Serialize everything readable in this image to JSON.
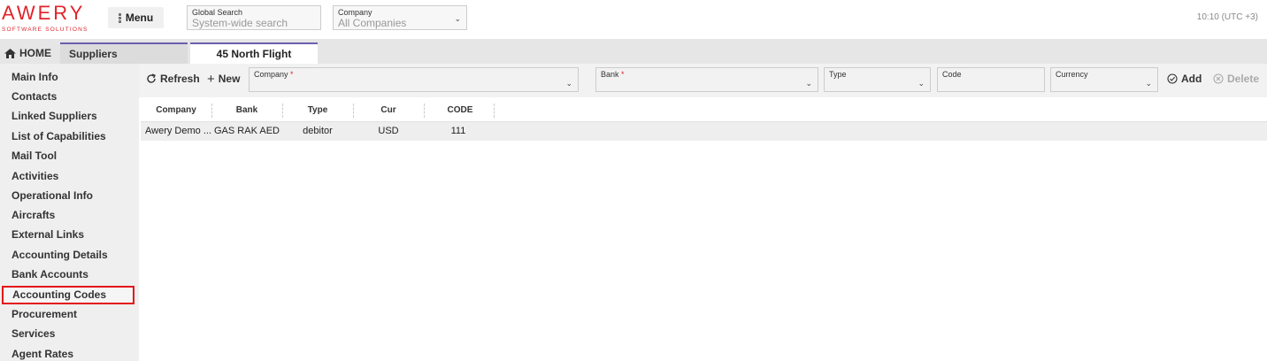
{
  "header": {
    "logo_main": "AWERY",
    "logo_sub": "SOFTWARE SOLUTIONS",
    "menu_label": "Menu",
    "global_search": {
      "label": "Global Search",
      "placeholder": "System-wide search"
    },
    "company": {
      "label": "Company",
      "value": "All Companies"
    },
    "clock": "10:10 (UTC +3)"
  },
  "tabs": {
    "home": "HOME",
    "suppliers": "Suppliers",
    "active": "45 North Flight"
  },
  "sidebar": {
    "items": [
      "Main Info",
      "Contacts",
      "Linked Suppliers",
      "List of Capabilities",
      "Mail Tool",
      "Activities",
      "Operational Info",
      "Aircrafts",
      "External Links",
      "Accounting Details",
      "Bank Accounts",
      "Accounting Codes",
      "Procurement",
      "Services",
      "Agent Rates"
    ],
    "selected_index": 11
  },
  "toolbar": {
    "refresh": "Refresh",
    "new": "New",
    "company_label": "Company",
    "bank_label": "Bank",
    "type_label": "Type",
    "code_label": "Code",
    "currency_label": "Currency",
    "add": "Add",
    "delete": "Delete",
    "required_mark": "*"
  },
  "grid": {
    "columns": [
      "Company",
      "Bank",
      "Type",
      "Cur",
      "CODE"
    ],
    "rows": [
      [
        "Awery Demo ...",
        "GAS RAK AED",
        "debitor",
        "USD",
        "111"
      ]
    ]
  },
  "colors": {
    "brand": "#e0232b",
    "tab_accent": "#6a5fb0",
    "highlight": "#e4141a"
  }
}
